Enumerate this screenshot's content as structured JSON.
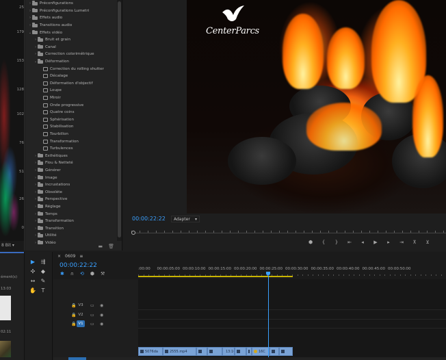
{
  "scope": {
    "ticks": [
      "25",
      "179",
      "153",
      "128",
      "102",
      "76",
      "51",
      "26",
      "0"
    ],
    "bit_depth": "8 Bit"
  },
  "effects": {
    "items": [
      {
        "label": "Préconfigurations",
        "level": 0,
        "kind": "folder",
        "open": false
      },
      {
        "label": "Préconfigurations Lumetri",
        "level": 0,
        "kind": "folder",
        "open": false
      },
      {
        "label": "Effets audio",
        "level": 0,
        "kind": "folder",
        "open": false
      },
      {
        "label": "Transitions audio",
        "level": 0,
        "kind": "folder",
        "open": false
      },
      {
        "label": "Effets vidéo",
        "level": 0,
        "kind": "folder",
        "open": true
      },
      {
        "label": "Bruit et grain",
        "level": 1,
        "kind": "folder",
        "open": false
      },
      {
        "label": "Canal",
        "level": 1,
        "kind": "folder",
        "open": false
      },
      {
        "label": "Correction colorimétrique",
        "level": 1,
        "kind": "folder",
        "open": false
      },
      {
        "label": "Déformation",
        "level": 1,
        "kind": "folder",
        "open": true
      },
      {
        "label": "Correction du rolling shutter",
        "level": 2,
        "kind": "effect"
      },
      {
        "label": "Décalage",
        "level": 2,
        "kind": "effect"
      },
      {
        "label": "Déformation d'objectif",
        "level": 2,
        "kind": "effect"
      },
      {
        "label": "Loupe",
        "level": 2,
        "kind": "effect"
      },
      {
        "label": "Miroir",
        "level": 2,
        "kind": "effect"
      },
      {
        "label": "Onde progressive",
        "level": 2,
        "kind": "effect"
      },
      {
        "label": "Quatre coins",
        "level": 2,
        "kind": "effect"
      },
      {
        "label": "Sphérisation",
        "level": 2,
        "kind": "effect"
      },
      {
        "label": "Stabilisation",
        "level": 2,
        "kind": "effect"
      },
      {
        "label": "Tourbillon",
        "level": 2,
        "kind": "effect"
      },
      {
        "label": "Transformation",
        "level": 2,
        "kind": "effect"
      },
      {
        "label": "Turbulences",
        "level": 2,
        "kind": "effect"
      },
      {
        "label": "Esthétiques",
        "level": 1,
        "kind": "folder",
        "open": false
      },
      {
        "label": "Flou & Netteté",
        "level": 1,
        "kind": "folder",
        "open": false
      },
      {
        "label": "Générer",
        "level": 1,
        "kind": "folder",
        "open": false
      },
      {
        "label": "Image",
        "level": 1,
        "kind": "folder",
        "open": false
      },
      {
        "label": "Incrustations",
        "level": 1,
        "kind": "folder",
        "open": false
      },
      {
        "label": "Obsolète",
        "level": 1,
        "kind": "folder",
        "open": false
      },
      {
        "label": "Perspective",
        "level": 1,
        "kind": "folder",
        "open": false
      },
      {
        "label": "Réglage",
        "level": 1,
        "kind": "folder",
        "open": false
      },
      {
        "label": "Temps",
        "level": 1,
        "kind": "folder",
        "open": false
      },
      {
        "label": "Transformation",
        "level": 1,
        "kind": "folder",
        "open": false
      },
      {
        "label": "Transition",
        "level": 1,
        "kind": "folder",
        "open": false
      },
      {
        "label": "Utilité",
        "level": 1,
        "kind": "folder",
        "open": false
      },
      {
        "label": "Vidéo",
        "level": 1,
        "kind": "folder",
        "open": false
      }
    ],
    "new_bin_icon": "folder-icon",
    "delete_icon": "trash-icon"
  },
  "monitor": {
    "brand": "CenterParcs",
    "timecode": "00:00:22:22",
    "fit_label": "Adapter"
  },
  "project": {
    "items_text": "ément(s)",
    "time1": "13:03",
    "time2": "02:11"
  },
  "timeline": {
    "sequence_name": "0609",
    "timecode": "00:00:22:22",
    "ruler_labels": [
      ":00:00",
      "00:00:05:00",
      "00:00:10:00",
      "00:00:15:00",
      "00:00:20:00",
      "00:00:25:00",
      "00:00:30:00",
      "00:00:35:00",
      "00:00:40:00",
      "00:00:45:00",
      "00:00:50:00"
    ],
    "tracks": [
      "V3",
      "V2",
      "V1"
    ],
    "clips": [
      {
        "label": "5076da",
        "fx": "blue"
      },
      {
        "label": "2555.mp4",
        "fx": "blue"
      },
      {
        "label": "",
        "fx": "blue"
      },
      {
        "label": "",
        "fx": "blue"
      },
      {
        "label": "13:1€",
        "fx": "blue"
      },
      {
        "label": "",
        "fx": "blue"
      },
      {
        "label": "",
        "fx": "blue"
      },
      {
        "label": "16C",
        "fx": "yellow"
      },
      {
        "label": "",
        "fx": "blue"
      },
      {
        "label": "",
        "fx": "blue"
      }
    ]
  },
  "colors": {
    "accent": "#3aa0ff",
    "clip": "#7aa3d6",
    "track_selected": "#2c6fb3",
    "work_area": "#c8b400"
  }
}
